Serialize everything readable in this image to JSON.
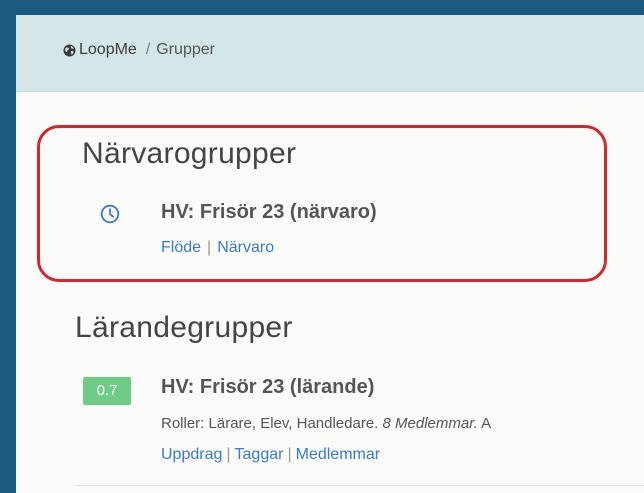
{
  "breadcrumb": {
    "root": "LoopMe",
    "separator": "/",
    "current": "Grupper"
  },
  "sections": {
    "attendance": {
      "heading": "Närvarogrupper",
      "group": {
        "icon": "clock-icon",
        "title": "HV: Frisör 23 (närvaro)",
        "links": [
          "Flöde",
          "Närvaro"
        ],
        "separator": "|"
      }
    },
    "learning": {
      "heading": "Lärandegrupper",
      "group": {
        "score": "0.7",
        "title": "HV: Frisör 23 (lärande)",
        "roles": "Roller: Lärare, Elev, Handledare.",
        "members": "8 Medlemmar.",
        "overflow": "A",
        "links": [
          "Uppdrag",
          "Taggar",
          "Medlemmar"
        ],
        "separator": "|"
      }
    }
  },
  "colors": {
    "frame": "#1d5a80",
    "header_bar": "#d5e6e9",
    "highlight": "#d3262f",
    "link": "#3a7bc8",
    "badge": "#6ecc87"
  }
}
